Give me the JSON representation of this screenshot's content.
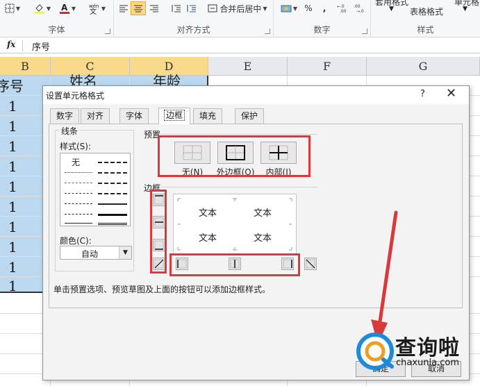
{
  "ribbon": {
    "groups": {
      "font": "字体",
      "alignment": "对齐方式",
      "number": "数字",
      "styles": "样式"
    },
    "merge_center": "合并后居中",
    "percent": "%",
    "comma": ",",
    "decimal_inc": "←.0\n.00",
    "styles_top": "套用格式",
    "table_format": "表格格式",
    "cell_styles": "单元格"
  },
  "formula_bar": {
    "fx": "fx",
    "value": "序号"
  },
  "sheet": {
    "columns": [
      "B",
      "C",
      "D",
      "E",
      "F",
      "G"
    ],
    "header_cells": [
      "序号",
      "姓名",
      "年龄"
    ],
    "rows": [
      "1",
      "1",
      "1",
      "1",
      "1",
      "1",
      "1",
      "1",
      "1",
      "1",
      "1"
    ]
  },
  "dialog": {
    "title": "设置单元格格式",
    "help": "?",
    "close": "✕",
    "tabs": [
      "数字",
      "对齐",
      "字体",
      "边框",
      "填充",
      "保护"
    ],
    "active_tab": "边框",
    "line_group": "线条",
    "style_label": "样式(S):",
    "none_style": "无",
    "color_label": "颜色(C):",
    "color_value": "自动",
    "presets_group": "预置",
    "presets": [
      "无(N)",
      "外边框(O)",
      "内部(I)"
    ],
    "border_group": "边框",
    "preview_text": [
      "文本",
      "文本",
      "文本",
      "文本"
    ],
    "note": "单击预置选项、预览草图及上面的按钮可以添加边框样式。",
    "ok": "确定",
    "cancel": "取消"
  },
  "watermark": {
    "name": "查询啦",
    "url": "chaxunla.com"
  },
  "colors": {
    "highlight_red": "#d9393a",
    "selection": "#bcd8ee",
    "header_selected": "#f9d98a"
  }
}
